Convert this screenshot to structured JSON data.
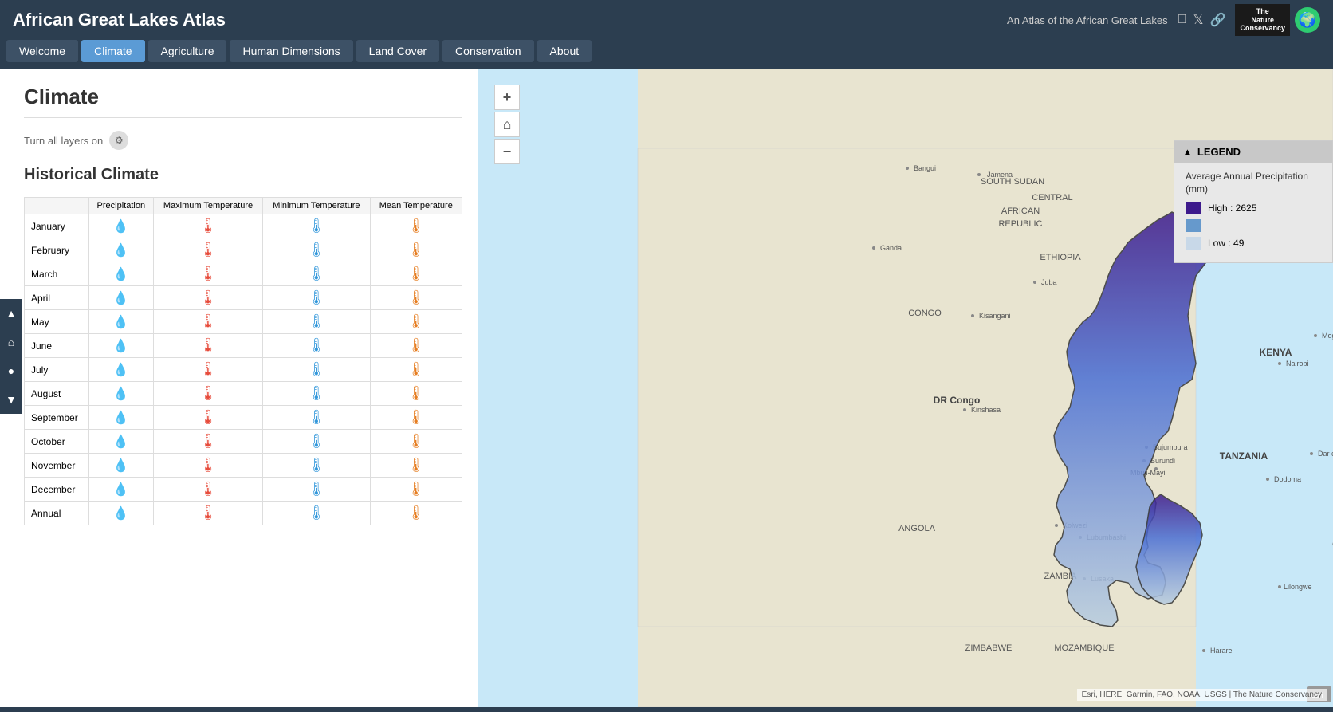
{
  "app": {
    "title": "African Great Lakes Atlas",
    "subtitle": "An Atlas of the African Great Lakes"
  },
  "nav": {
    "tabs": [
      {
        "id": "welcome",
        "label": "Welcome",
        "active": false
      },
      {
        "id": "climate",
        "label": "Climate",
        "active": true
      },
      {
        "id": "agriculture",
        "label": "Agriculture",
        "active": false
      },
      {
        "id": "human-dimensions",
        "label": "Human Dimensions",
        "active": false
      },
      {
        "id": "land-cover",
        "label": "Land Cover",
        "active": false
      },
      {
        "id": "conservation",
        "label": "Conservation",
        "active": false
      },
      {
        "id": "about",
        "label": "About",
        "active": false
      }
    ]
  },
  "sidebar": {
    "section_title": "Climate",
    "layers_toggle_label": "Turn all layers on",
    "historical_title": "Historical Climate",
    "table": {
      "headers": {
        "precipitation": "Precipitation",
        "max_temp": "Maximum Temperature",
        "min_temp": "Minimum Temperature",
        "mean_temp": "Mean Temperature"
      },
      "months": [
        "January",
        "February",
        "March",
        "April",
        "May",
        "June",
        "July",
        "August",
        "September",
        "October",
        "November",
        "December",
        "Annual"
      ]
    }
  },
  "legend": {
    "title": "LEGEND",
    "layer_title": "Average Annual Precipitation (mm)",
    "high_label": "High : 2625",
    "low_label": "Low : 49",
    "colors": {
      "high": "#3d1a8c",
      "mid": "#6699cc",
      "low": "#c8d8e8"
    }
  },
  "map": {
    "attribution": "Esri, HERE, Garmin, FAO, NOAA, USGS | The Nature Conservancy",
    "controls": {
      "zoom_in": "+",
      "home": "⌂",
      "zoom_out": "−"
    }
  }
}
